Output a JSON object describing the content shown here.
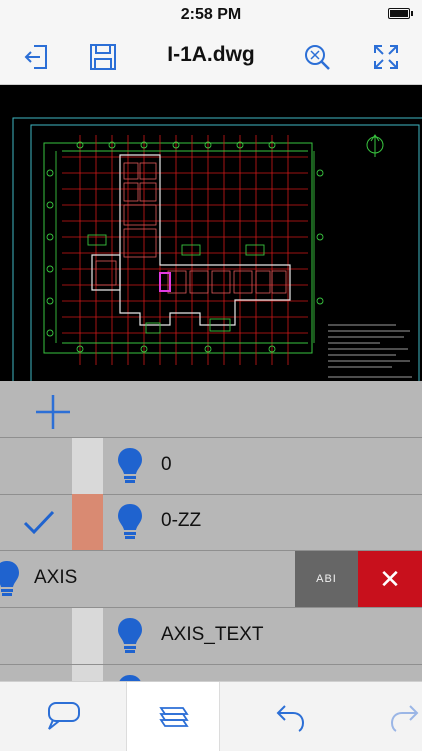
{
  "status": {
    "time": "2:58 PM"
  },
  "nav": {
    "title": "I-1A.dwg",
    "buttons": [
      "exit-icon",
      "save-icon",
      "zoom-window-icon",
      "zoom-extents-icon"
    ]
  },
  "layers": {
    "items": [
      {
        "name": "0",
        "color": "#d9d9d9",
        "current": false
      },
      {
        "name": "0-ZZ",
        "color": "#d98a72",
        "current": true
      },
      {
        "name": "AXIS",
        "color": "#ffffff",
        "current": false,
        "swiped": true
      },
      {
        "name": "AXIS_TEXT",
        "color": "#d9d9d9",
        "current": false
      }
    ],
    "row_actions": {
      "rename_label": "ABI",
      "delete_label": "✕"
    }
  },
  "tabbar": {
    "tabs": [
      "comment-icon",
      "layers-icon",
      "undo-icon",
      "redo-icon"
    ],
    "selected": "layers-icon"
  },
  "colors": {
    "accent": "#2c6fd6",
    "delete": "#c8101c",
    "drawing_bg": "#000000"
  }
}
